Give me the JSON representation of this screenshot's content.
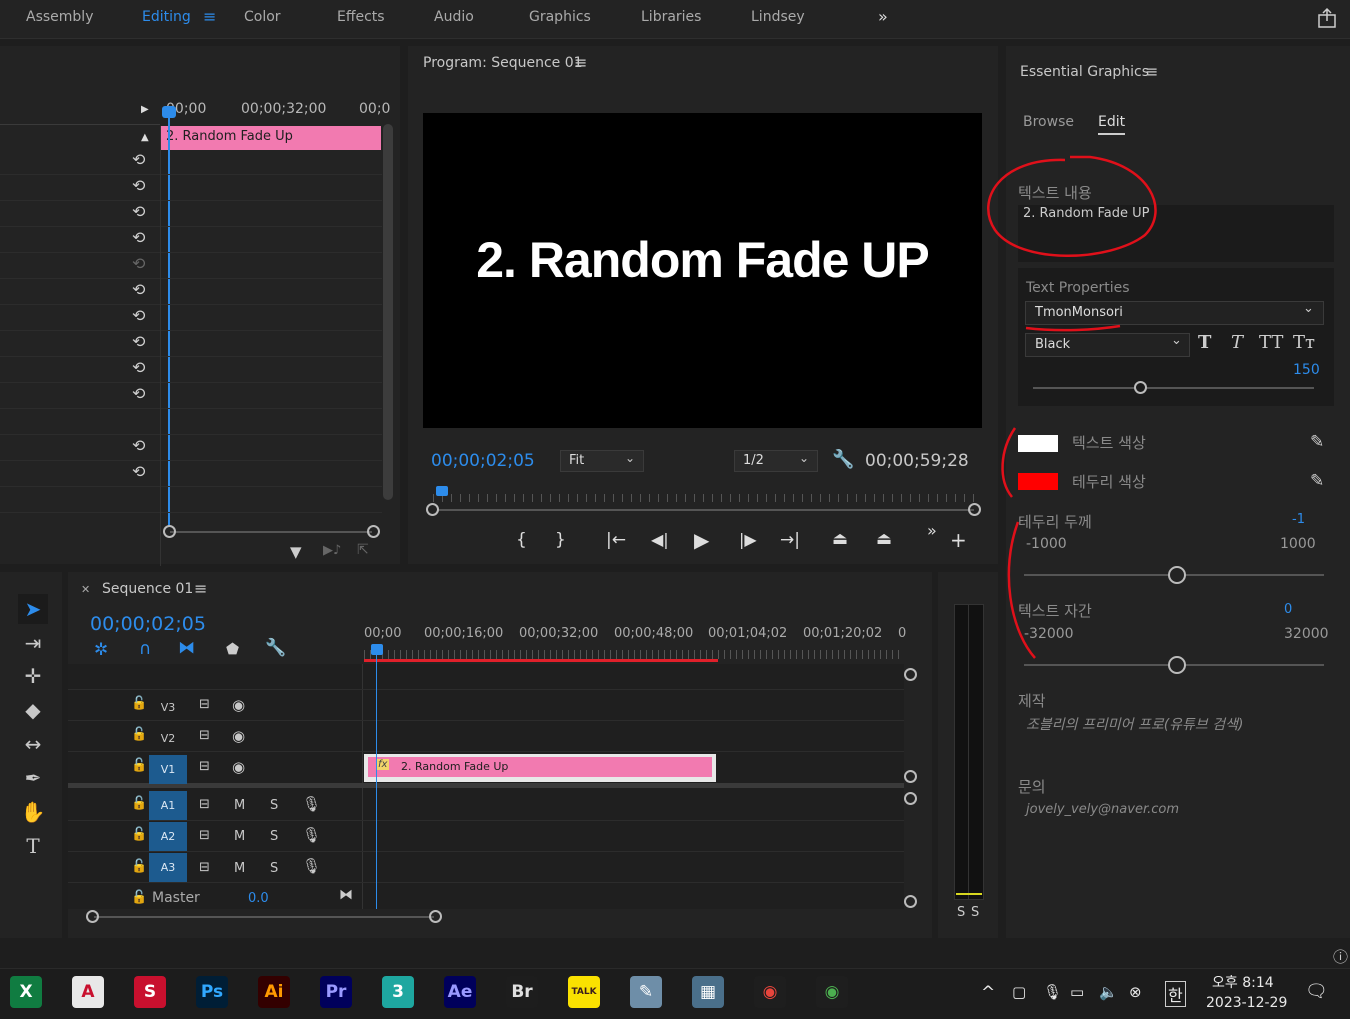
{
  "workspaces": [
    {
      "label": "Assembly",
      "active": false
    },
    {
      "label": "Editing",
      "active": true
    },
    {
      "label": "Color",
      "active": false
    },
    {
      "label": "Effects",
      "active": false
    },
    {
      "label": "Audio",
      "active": false
    },
    {
      "label": "Graphics",
      "active": false
    },
    {
      "label": "Libraries",
      "active": false
    },
    {
      "label": "Lindsey",
      "active": false
    }
  ],
  "source_panel": {
    "timecodes": [
      "00;00",
      "00;00;32;00",
      "00;0"
    ],
    "clip_name": "2. Random Fade Up"
  },
  "program": {
    "title": "Program: Sequence 01",
    "overlay_text": "2. Random Fade UP",
    "current_time": "00;00;02;05",
    "fit": "Fit",
    "resolution": "1/2",
    "duration": "00;00;59;28"
  },
  "essential_graphics": {
    "title": "Essential Graphics",
    "tabs": [
      "Browse",
      "Edit"
    ],
    "text_content_label": "텍스트 내용",
    "text_content_value": "2. Random Fade UP",
    "text_properties_label": "Text Properties",
    "font": "TmonMonsori",
    "font_style": "Black",
    "font_size": "150",
    "text_color_label": "텍스트 색상",
    "text_color": "#ffffff",
    "stroke_color_label": "테두리 색상",
    "stroke_color": "#ff0000",
    "stroke_width_label": "테두리 두께",
    "stroke_width_value": "-1",
    "stroke_width_min": "-1000",
    "stroke_width_max": "1000",
    "tracking_label": "텍스트 자간",
    "tracking_value": "0",
    "tracking_min": "-32000",
    "tracking_max": "32000",
    "credit_label": "제작",
    "credit_value": "조블리의 프리미어 프로(유튜브 검색)",
    "contact_label": "문의",
    "contact_value": "jovely_vely@naver.com"
  },
  "sequence": {
    "tab": "Sequence 01",
    "current_time": "00;00;02;05",
    "ruler": [
      "00;00",
      "00;00;16;00",
      "00;00;32;00",
      "00;00;48;00",
      "00;01;04;02",
      "00;01;20;02",
      "0"
    ],
    "video_tracks": [
      "V3",
      "V2",
      "V1"
    ],
    "audio_tracks": [
      "A1",
      "A2",
      "A3"
    ],
    "clip_name": "2. Random Fade Up",
    "fx_badge": "fx",
    "master_label": "Master",
    "master_value": "0.0",
    "m": "M",
    "s": "S"
  },
  "meter": {
    "labels": [
      "S",
      "S"
    ]
  },
  "taskbar": {
    "apps": [
      {
        "name": "excel",
        "label": "X",
        "bg": "#107c41",
        "color": "#ffffff"
      },
      {
        "name": "autocad",
        "label": "A",
        "bg": "#e8e8e8",
        "color": "#c8102e"
      },
      {
        "name": "sketchup",
        "label": "S",
        "bg": "#c8102e",
        "color": "#ffffff"
      },
      {
        "name": "photoshop",
        "label": "Ps",
        "bg": "#001e36",
        "color": "#31a8ff"
      },
      {
        "name": "illustrator",
        "label": "Ai",
        "bg": "#330000",
        "color": "#ff9a00"
      },
      {
        "name": "premiere",
        "label": "Pr",
        "bg": "#00005b",
        "color": "#9999ff"
      },
      {
        "name": "3dsmax",
        "label": "3",
        "bg": "#1ea7a0",
        "color": "#ffffff"
      },
      {
        "name": "after-effects",
        "label": "Ae",
        "bg": "#00005b",
        "color": "#9999ff"
      },
      {
        "name": "bridge",
        "label": "Br",
        "bg": "#1d1d1d",
        "color": "#e0e0e0"
      },
      {
        "name": "kakaotalk",
        "label": "TALK",
        "bg": "#fae100",
        "color": "#3a1d1d"
      },
      {
        "name": "notes",
        "label": "✎",
        "bg": "#6e8ea8",
        "color": "#ffffff"
      },
      {
        "name": "calculator",
        "label": "▦",
        "bg": "#4a6f8a",
        "color": "#ffffff"
      },
      {
        "name": "chrome-profile",
        "label": "◉",
        "bg": "#1e1e1e",
        "color": "#e8453c"
      },
      {
        "name": "chrome",
        "label": "◉",
        "bg": "#1e1e1e",
        "color": "#4caf50"
      }
    ],
    "ime": "한",
    "time": "오후 8:14",
    "date": "2023-12-29"
  }
}
